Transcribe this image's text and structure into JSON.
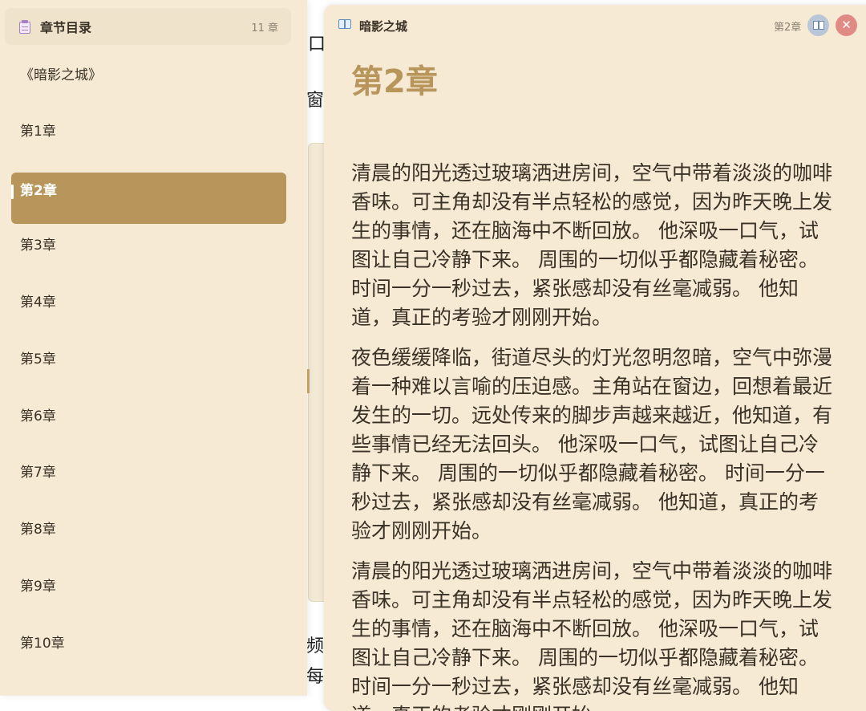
{
  "sidebar": {
    "title": "章节目录",
    "count": "11 章",
    "book_title": "《暗影之城》",
    "chapters": [
      {
        "label": "第1章",
        "active": false
      },
      {
        "label": "第2章",
        "active": true
      },
      {
        "label": "第3章",
        "active": false
      },
      {
        "label": "第4章",
        "active": false
      },
      {
        "label": "第5章",
        "active": false
      },
      {
        "label": "第6章",
        "active": false
      },
      {
        "label": "第7章",
        "active": false
      },
      {
        "label": "第8章",
        "active": false
      },
      {
        "label": "第9章",
        "active": false
      },
      {
        "label": "第10章",
        "active": false
      }
    ]
  },
  "background_text": {
    "char_1": "口",
    "char_2": "窗",
    "char_3": "频",
    "char_4": "每"
  },
  "reader": {
    "book_title": "暗影之城",
    "chapter_label": "第2章",
    "close_symbol": "✕",
    "chapter_heading": "第2章",
    "paragraphs": [
      "清晨的阳光透过玻璃洒进房间，空气中带着淡淡的咖啡香味。可主角却没有半点轻松的感觉，因为昨天晚上发生的事情，还在脑海中不断回放。 他深吸一口气，试图让自己冷静下来。 周围的一切似乎都隐藏着秘密。 时间一分一秒过去，紧张感却没有丝毫减弱。 他知道，真正的考验才刚刚开始。",
      "夜色缓缓降临，街道尽头的灯光忽明忽暗，空气中弥漫着一种难以言喻的压迫感。主角站在窗边，回想着最近发生的一切。远处传来的脚步声越来越近，他知道，有些事情已经无法回头。 他深吸一口气，试图让自己冷静下来。 周围的一切似乎都隐藏着秘密。 时间一分一秒过去，紧张感却没有丝毫减弱。 他知道，真正的考验才刚刚开始。",
      "清晨的阳光透过玻璃洒进房间，空气中带着淡淡的咖啡香味。可主角却没有半点轻松的感觉，因为昨天晚上发生的事情，还在脑海中不断回放。 他深吸一口气，试图让自己冷静下来。 周围的一切似乎都隐藏着秘密。 时间一分一秒过去，紧张感却没有丝毫减弱。 他知道，真正的考验才刚刚开始。"
    ]
  },
  "colors": {
    "accent": "#b8955a",
    "panel_bg": "#f6ead4",
    "text": "#3a3226",
    "close_button": "#e08a86",
    "toc_button": "#b9c6d8"
  }
}
